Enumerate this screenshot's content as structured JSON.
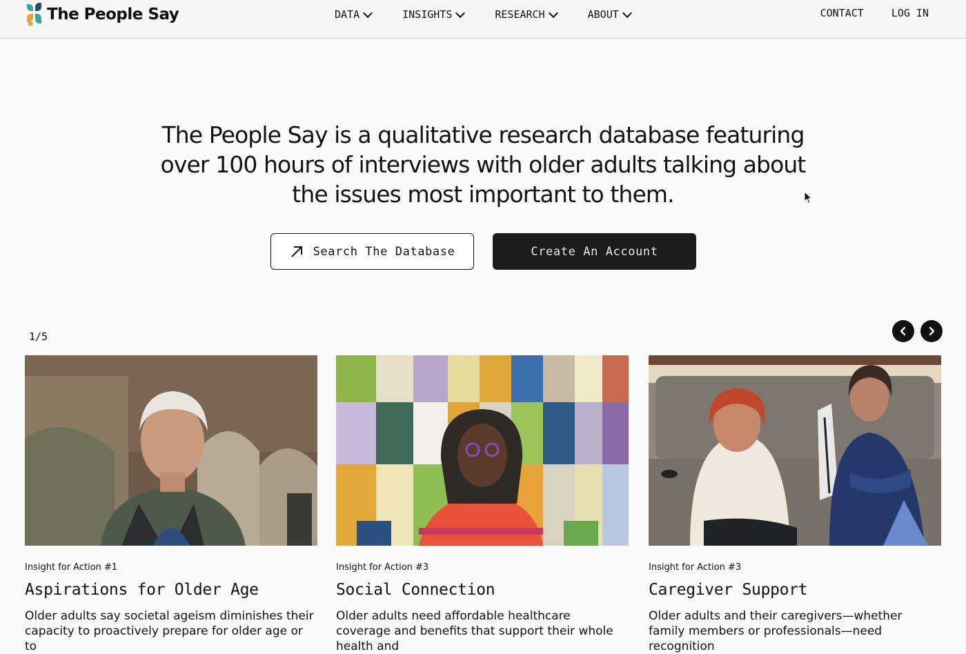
{
  "brand": {
    "name": "The People Say",
    "colors": {
      "teal": "#3aa6a0",
      "orange": "#e8a33d",
      "navy": "#2b4a7a"
    }
  },
  "nav": {
    "menu": [
      {
        "label": "DATA"
      },
      {
        "label": "INSIGHTS"
      },
      {
        "label": "RESEARCH"
      },
      {
        "label": "ABOUT"
      }
    ],
    "contact": "CONTACT",
    "login": "LOG IN"
  },
  "hero": {
    "headline": "The People Say is a qualitative research database featuring over 100 hours of interviews with older adults talking about the issues most important to them.",
    "search_button": "Search The Database",
    "account_button": "Create An Account"
  },
  "carousel": {
    "counter": "1/5",
    "cards": [
      {
        "kicker": "Insight for Action #1",
        "title": "Aspirations for Older Age",
        "description": "Older adults say societal ageism diminishes  their capacity to proactively prepare for older age or to"
      },
      {
        "kicker": "Insight for Action #3",
        "title": "Social Connection",
        "description": "Older adults need affordable healthcare coverage and benefits that support their whole health and"
      },
      {
        "kicker": "Insight for Action #3",
        "title": "Caregiver Support",
        "description": "Older adults and their caregivers—whether family members or professionals—need recognition"
      }
    ]
  }
}
